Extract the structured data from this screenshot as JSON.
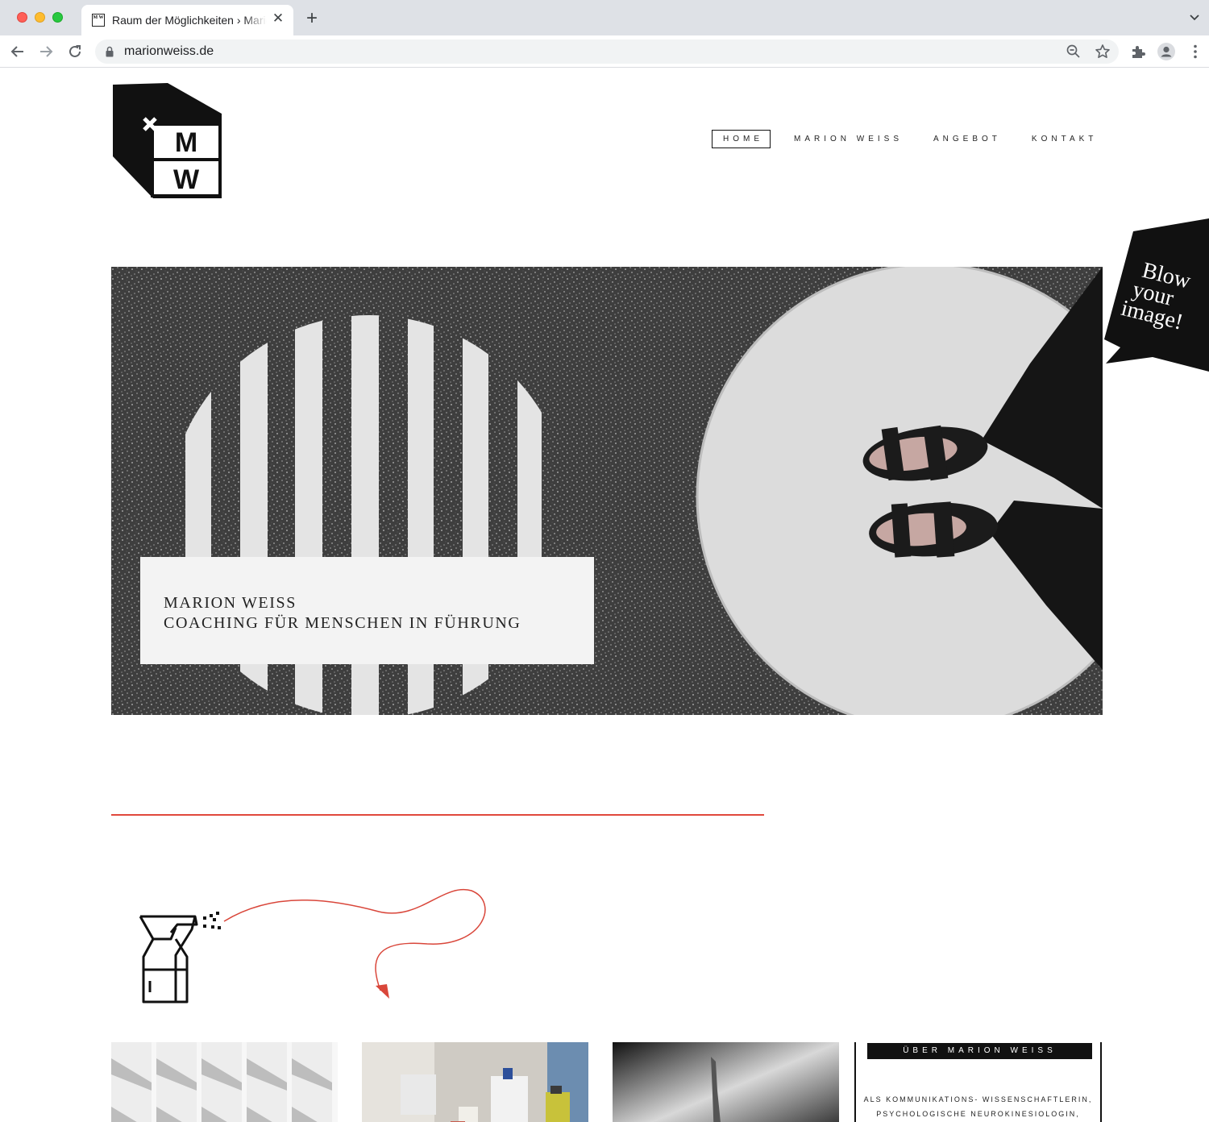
{
  "browser": {
    "tab": {
      "favicon_text": "M W",
      "title": "Raum der Möglichkeiten › Marion Weiss",
      "close_label": "✕"
    },
    "new_tab_label": "+",
    "address_bar": {
      "url": "marionweiss.de"
    },
    "icons": [
      "back-arrow-icon",
      "forward-arrow-icon",
      "reload-icon",
      "lock-icon",
      "zoom-icon",
      "star-icon",
      "extensions-icon",
      "profile-icon",
      "menu-icon",
      "tab-list-icon"
    ]
  },
  "site": {
    "logo": {
      "letters": [
        "M",
        "W"
      ]
    },
    "nav": [
      {
        "label": "HOME",
        "active": true
      },
      {
        "label": "MARION WEISS",
        "active": false
      },
      {
        "label": "ANGEBOT",
        "active": false
      },
      {
        "label": "KONTAKT",
        "active": false
      }
    ],
    "sticker": {
      "lines": [
        "Blow",
        "your",
        "image!"
      ]
    },
    "hero": {
      "line1": "MARION WEISS",
      "line2": "COACHING FÜR MENSCHEN IN FÜHRUNG"
    },
    "about": {
      "heading": "ÜBER MARION WEISS",
      "line1": "ALS KOMMUNIKATIONS- WISSENSCHAFTLERIN,",
      "line2": "PSYCHOLOGISCHE NEUROKINESIOLOGIN,"
    },
    "colors": {
      "accent_red": "#e0483c",
      "black": "#111111"
    }
  }
}
